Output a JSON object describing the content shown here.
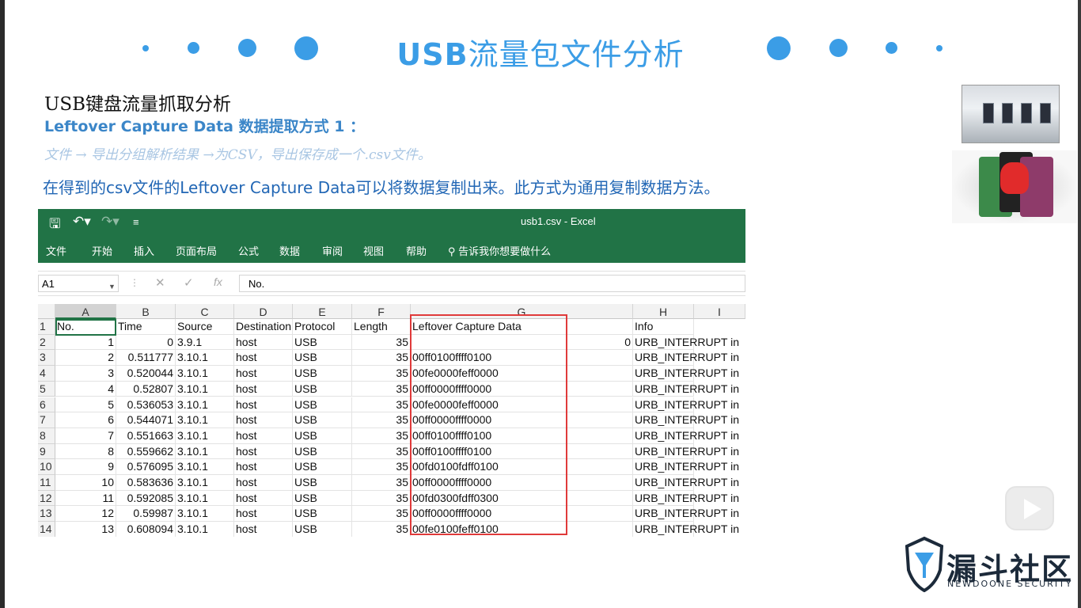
{
  "slide": {
    "title_bold": "USB",
    "title_rest": "流量包文件分析",
    "heading": "USB键盘流量抓取分析",
    "subheading": "Leftover Capture Data 数据提取方式 1 ：",
    "path_text": "文件 → 导出分组解析结果 →为CSV，导出保存成一个.csv文件。",
    "description": "在得到的csv文件的Leftover Capture Data可以将数据复制出来。此方式为通用复制数据方法。",
    "accent_color": "#3b9de6"
  },
  "excel": {
    "window_title": "usb1.csv  -  Excel",
    "qat": [
      "save-icon",
      "undo-icon",
      "redo-icon",
      "customize-icon"
    ],
    "menu": [
      "文件",
      "开始",
      "插入",
      "页面布局",
      "公式",
      "数据",
      "审阅",
      "视图",
      "帮助"
    ],
    "tell_me": "告诉我你想要做什么",
    "name_box": "A1",
    "formula_value": "No.",
    "columns": [
      "A",
      "B",
      "C",
      "D",
      "E",
      "F",
      "G",
      "H",
      "I"
    ],
    "rows": [
      "1",
      "2",
      "3",
      "4",
      "5",
      "6",
      "7",
      "8",
      "9",
      "10",
      "11",
      "12",
      "13",
      "14"
    ],
    "header": [
      "No.",
      "Time",
      "Source",
      "Destination",
      "Protocol",
      "Length",
      "Leftover Capture Data",
      "Info"
    ],
    "data": [
      [
        "1",
        "0",
        "3.9.1",
        "host",
        "USB",
        "35",
        "",
        "0",
        "URB_INTERRUPT in"
      ],
      [
        "2",
        "0.511777",
        "3.10.1",
        "host",
        "USB",
        "35",
        "00ff0100ffff0100",
        "",
        "URB_INTERRUPT in"
      ],
      [
        "3",
        "0.520044",
        "3.10.1",
        "host",
        "USB",
        "35",
        "00fe0000feff0000",
        "",
        "URB_INTERRUPT in"
      ],
      [
        "4",
        "0.52807",
        "3.10.1",
        "host",
        "USB",
        "35",
        "00ff0000ffff0000",
        "",
        "URB_INTERRUPT in"
      ],
      [
        "5",
        "0.536053",
        "3.10.1",
        "host",
        "USB",
        "35",
        "00fe0000feff0000",
        "",
        "URB_INTERRUPT in"
      ],
      [
        "6",
        "0.544071",
        "3.10.1",
        "host",
        "USB",
        "35",
        "00ff0000ffff0000",
        "",
        "URB_INTERRUPT in"
      ],
      [
        "7",
        "0.551663",
        "3.10.1",
        "host",
        "USB",
        "35",
        "00ff0100ffff0100",
        "",
        "URB_INTERRUPT in"
      ],
      [
        "8",
        "0.559662",
        "3.10.1",
        "host",
        "USB",
        "35",
        "00ff0100ffff0100",
        "",
        "URB_INTERRUPT in"
      ],
      [
        "9",
        "0.576095",
        "3.10.1",
        "host",
        "USB",
        "35",
        "00fd0100fdff0100",
        "",
        "URB_INTERRUPT in"
      ],
      [
        "10",
        "0.583636",
        "3.10.1",
        "host",
        "USB",
        "35",
        "00ff0000ffff0000",
        "",
        "URB_INTERRUPT in"
      ],
      [
        "11",
        "0.592085",
        "3.10.1",
        "host",
        "USB",
        "35",
        "00fd0300fdff0300",
        "",
        "URB_INTERRUPT in"
      ],
      [
        "12",
        "0.59987",
        "3.10.1",
        "host",
        "USB",
        "35",
        "00ff0000ffff0000",
        "",
        "URB_INTERRUPT in"
      ],
      [
        "13",
        "0.608094",
        "3.10.1",
        "host",
        "USB",
        "35",
        "00fe0100feff0100",
        "",
        "URB_INTERRUPT in"
      ]
    ],
    "ribbon_color": "#217346",
    "highlight_color": "#e03a3a"
  },
  "branding": {
    "logo_name": "漏斗社区",
    "logo_sub": "NEWDOONE SECURITY"
  }
}
